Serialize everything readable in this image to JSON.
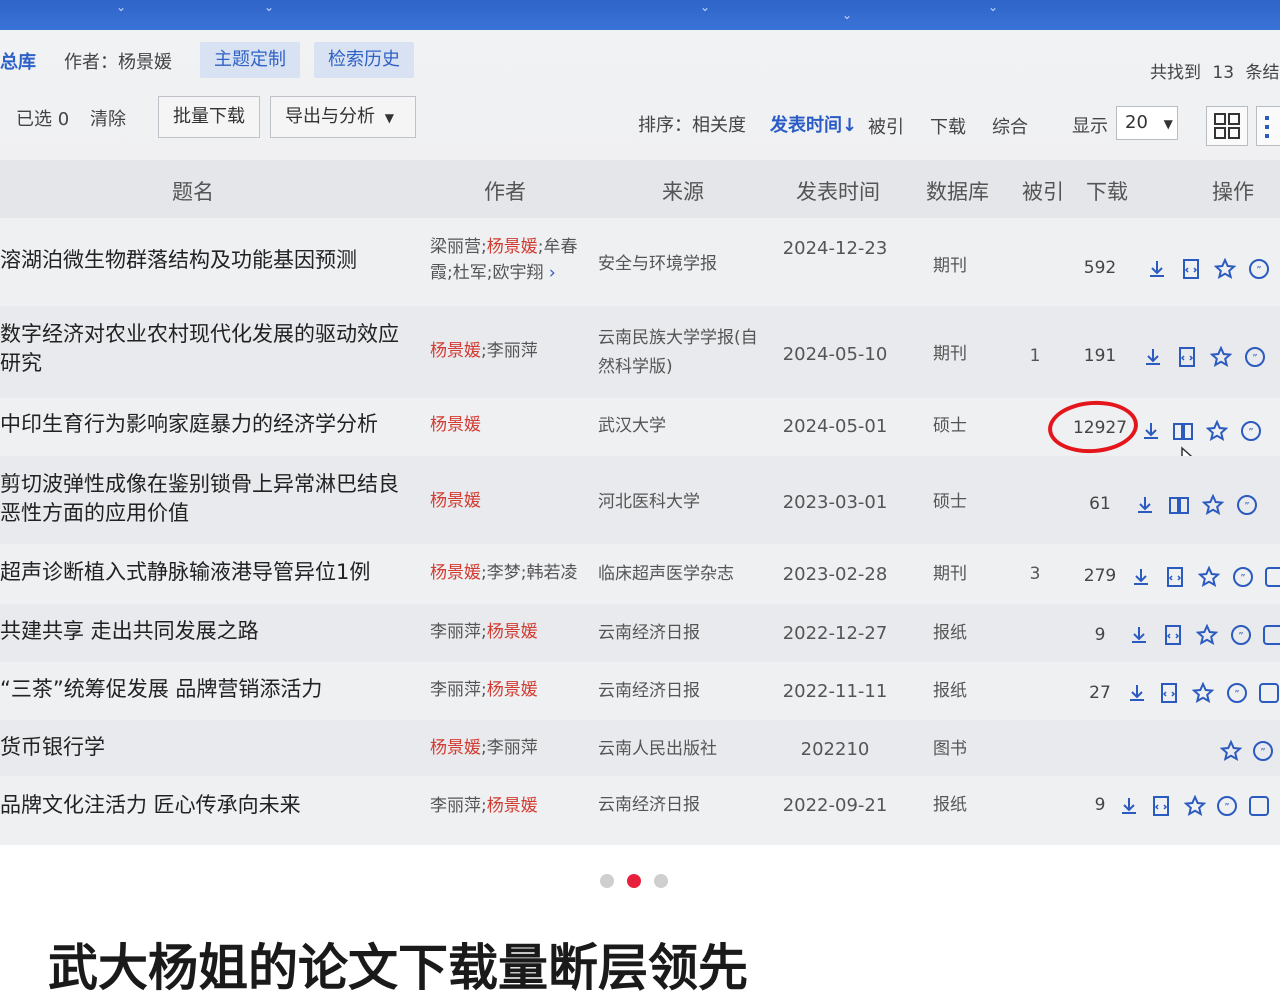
{
  "header": {
    "library_partial": "总库",
    "author_filter": "作者：杨景媛",
    "topic_custom": "主题定制",
    "search_history": "检索历史",
    "found_prefix": "共找到",
    "found_count": "13",
    "found_suffix": "条结"
  },
  "toolbar": {
    "selected": "已选 0",
    "clear": "清除",
    "batch_download": "批量下载",
    "export_analysis": "导出与分析",
    "sort_label": "排序：",
    "sort_relevance": "相关度",
    "sort_pubtime": "发表时间",
    "sort_cited": "被引",
    "sort_download": "下载",
    "sort_overall": "综合",
    "display_label": "显示",
    "display_value": "20"
  },
  "columns": {
    "title": "题名",
    "author": "作者",
    "source": "来源",
    "date": "发表时间",
    "database": "数据库",
    "cited": "被引",
    "downloads": "下载",
    "actions": "操作"
  },
  "rows": [
    {
      "title": "溶湖泊微生物群落结构及功能基因预测",
      "authors_a": "梁丽营;",
      "authors_hl": "杨景媛",
      "authors_b": ";牟春霞;杜军;欧宇翔",
      "source": "安全与环境学报",
      "date": "2024-12-23",
      "db": "期刊",
      "cited": "",
      "downloads": "592"
    },
    {
      "title": "数字经济对农业农村现代化发展的驱动效应研究",
      "authors_a": "",
      "authors_hl": "杨景媛",
      "authors_b": ";李丽萍",
      "source": "云南民族大学学报(自然科学版)",
      "date": "2024-05-10",
      "db": "期刊",
      "cited": "1",
      "downloads": "191"
    },
    {
      "title": "中印生育行为影响家庭暴力的经济学分析",
      "authors_a": "",
      "authors_hl": "杨景媛",
      "authors_b": "",
      "source": "武汉大学",
      "date": "2024-05-01",
      "db": "硕士",
      "cited": "",
      "downloads": "12927"
    },
    {
      "title": "剪切波弹性成像在鉴别锁骨上异常淋巴结良恶性方面的应用价值",
      "authors_a": "",
      "authors_hl": "杨景媛",
      "authors_b": "",
      "source": "河北医科大学",
      "date": "2023-03-01",
      "db": "硕士",
      "cited": "",
      "downloads": "61"
    },
    {
      "title": "超声诊断植入式静脉输液港导管异位1例",
      "authors_a": "",
      "authors_hl": "杨景媛",
      "authors_b": ";李梦;韩若凌",
      "source": "临床超声医学杂志",
      "date": "2023-02-28",
      "db": "期刊",
      "cited": "3",
      "downloads": "279"
    },
    {
      "title": "共建共享 走出共同发展之路",
      "authors_a": "李丽萍;",
      "authors_hl": "杨景媛",
      "authors_b": "",
      "source": "云南经济日报",
      "date": "2022-12-27",
      "db": "报纸",
      "cited": "",
      "downloads": "9"
    },
    {
      "title": "“三茶”统筹促发展 品牌营销添活力",
      "authors_a": "李丽萍;",
      "authors_hl": "杨景媛",
      "authors_b": "",
      "source": "云南经济日报",
      "date": "2022-11-11",
      "db": "报纸",
      "cited": "",
      "downloads": "27"
    },
    {
      "title": "货币银行学",
      "authors_a": "",
      "authors_hl": "杨景媛",
      "authors_b": ";李丽萍",
      "source": "云南人民出版社",
      "date": "202210",
      "db": "图书",
      "cited": "",
      "downloads": ""
    },
    {
      "title": "品牌文化注活力 匠心传承向未来",
      "authors_a": "李丽萍;",
      "authors_hl": "杨景媛",
      "authors_b": "",
      "source": "云南经济日报",
      "date": "2022-09-21",
      "db": "报纸",
      "cited": "",
      "downloads": "9"
    }
  ],
  "colors": {
    "highlight_author": "#d23b31",
    "circle": "#e4161b",
    "active_dot": "#e8203b",
    "accent": "#2a5bc6"
  },
  "caption": "武大杨姐的论文下载量断层领先"
}
